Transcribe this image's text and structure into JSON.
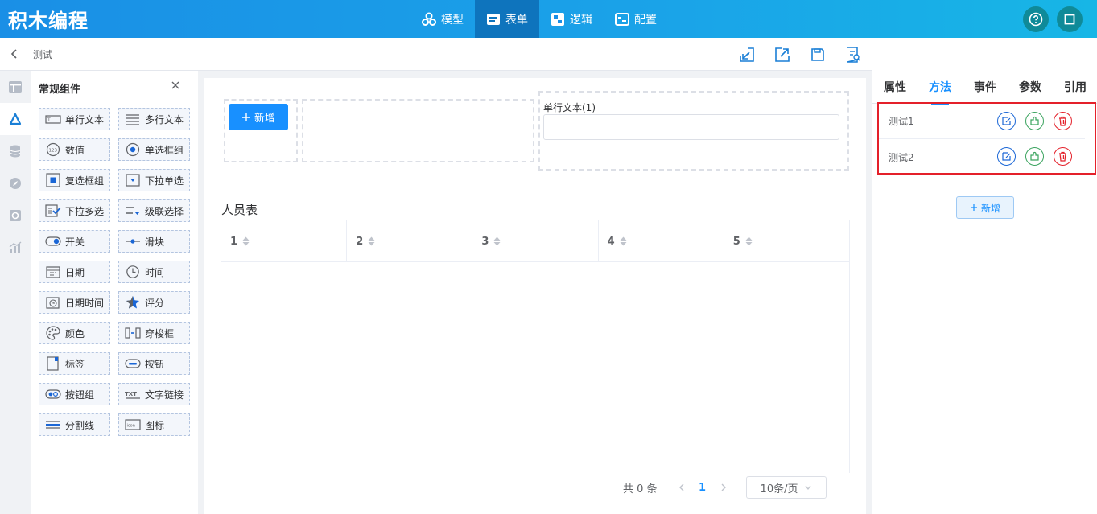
{
  "app": {
    "brand": "积木编程"
  },
  "topnav": [
    {
      "label": "模型",
      "icon": "model-icon",
      "active": false
    },
    {
      "label": "表单",
      "icon": "form-icon",
      "active": true
    },
    {
      "label": "逻辑",
      "icon": "logic-icon",
      "active": false
    },
    {
      "label": "配置",
      "icon": "config-icon",
      "active": false
    }
  ],
  "header": {
    "breadcrumb": "测试"
  },
  "panel": {
    "title": "常规组件",
    "components": [
      {
        "label": "单行文本",
        "icon": "single-line-text-icon"
      },
      {
        "label": "多行文本",
        "icon": "multi-line-text-icon"
      },
      {
        "label": "数值",
        "icon": "number-icon"
      },
      {
        "label": "单选框组",
        "icon": "radio-group-icon"
      },
      {
        "label": "复选框组",
        "icon": "checkbox-group-icon"
      },
      {
        "label": "下拉单选",
        "icon": "select-icon"
      },
      {
        "label": "下拉多选",
        "icon": "multi-select-icon"
      },
      {
        "label": "级联选择",
        "icon": "cascader-icon"
      },
      {
        "label": "开关",
        "icon": "switch-icon"
      },
      {
        "label": "滑块",
        "icon": "slider-icon"
      },
      {
        "label": "日期",
        "icon": "date-icon"
      },
      {
        "label": "时间",
        "icon": "time-icon"
      },
      {
        "label": "日期时间",
        "icon": "datetime-icon"
      },
      {
        "label": "评分",
        "icon": "rate-icon"
      },
      {
        "label": "颜色",
        "icon": "color-icon"
      },
      {
        "label": "穿梭框",
        "icon": "transfer-icon"
      },
      {
        "label": "标签",
        "icon": "tag-icon"
      },
      {
        "label": "按钮",
        "icon": "button-icon"
      },
      {
        "label": "按钮组",
        "icon": "button-group-icon"
      },
      {
        "label": "文字链接",
        "icon": "text-link-icon"
      },
      {
        "label": "分割线",
        "icon": "divider-icon"
      },
      {
        "label": "图标",
        "icon": "icon-icon"
      }
    ]
  },
  "canvas": {
    "add_button": "新增",
    "field_label": "单行文本(1)",
    "table_title": "人员表",
    "columns": [
      "1",
      "2",
      "3",
      "4",
      "5"
    ],
    "pager": {
      "total": "共 0 条",
      "current": "1",
      "page_size": "10条/页"
    }
  },
  "right": {
    "tabs": [
      "属性",
      "方法",
      "事件",
      "参数",
      "引用"
    ],
    "active_tab": "方法",
    "methods": [
      "测试1",
      "测试2"
    ],
    "add_label": "新增"
  },
  "colors": {
    "primary": "#1890ff",
    "highlight": "#e4202a",
    "topbar": "#1a8fe6"
  }
}
